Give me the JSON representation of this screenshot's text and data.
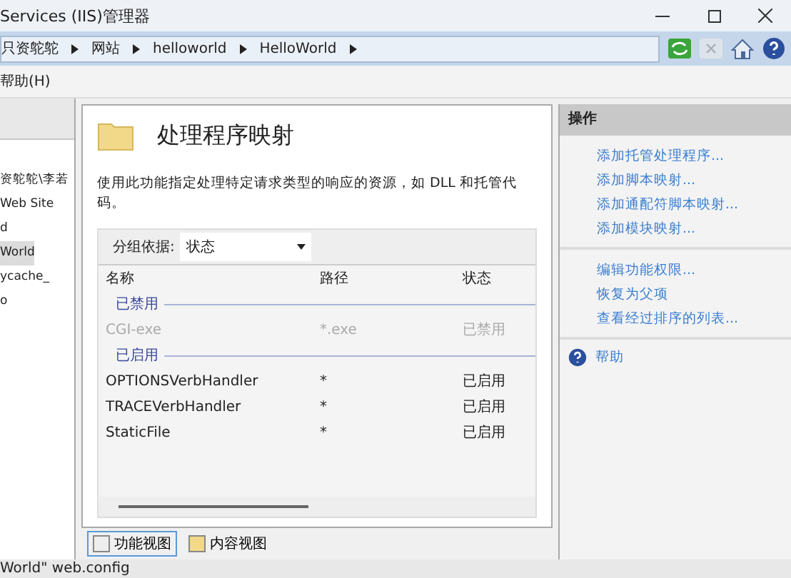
{
  "window": {
    "title": "Services (IIS)管理器"
  },
  "breadcrumb": [
    "只资鸵鸵",
    "网站",
    "helloworld",
    "HelloWorld"
  ],
  "menu": [
    "帮助(H)"
  ],
  "tree": [
    {
      "label": "资鸵鸵\\李若",
      "selected": false
    },
    {
      "label": "Web Site",
      "selected": false
    },
    {
      "label": "d",
      "selected": false
    },
    {
      "label": "World",
      "selected": true
    },
    {
      "label": "ycache_",
      "selected": false
    },
    {
      "label": "o",
      "selected": false
    }
  ],
  "feature": {
    "title": "处理程序映射",
    "description": "使用此功能指定处理特定请求类型的响应的资源，如 DLL 和托管代码。",
    "group_label": "分组依据:",
    "group_value": "状态",
    "columns": [
      "名称",
      "路径",
      "状态"
    ],
    "groups": [
      {
        "label": "已禁用",
        "rows": [
          {
            "name": "CGI-exe",
            "path": "*.exe",
            "state": "已禁用",
            "disabled": true
          }
        ]
      },
      {
        "label": "已启用",
        "rows": [
          {
            "name": "OPTIONSVerbHandler",
            "path": "*",
            "state": "已启用",
            "disabled": false
          },
          {
            "name": "TRACEVerbHandler",
            "path": "*",
            "state": "已启用",
            "disabled": false
          },
          {
            "name": "StaticFile",
            "path": "*",
            "state": "已启用",
            "disabled": false
          }
        ]
      }
    ]
  },
  "view_tabs": [
    {
      "label": "功能视图",
      "selected": true
    },
    {
      "label": "内容视图",
      "selected": false
    }
  ],
  "actions": {
    "title": "操作",
    "groups": [
      [
        "添加托管处理程序...",
        "添加脚本映射...",
        "添加通配符脚本映射...",
        "添加模块映射..."
      ],
      [
        "编辑功能权限...",
        "恢复为父项",
        "查看经过排序的列表..."
      ]
    ],
    "help": "帮助"
  },
  "status_bar": "World\" web.config"
}
